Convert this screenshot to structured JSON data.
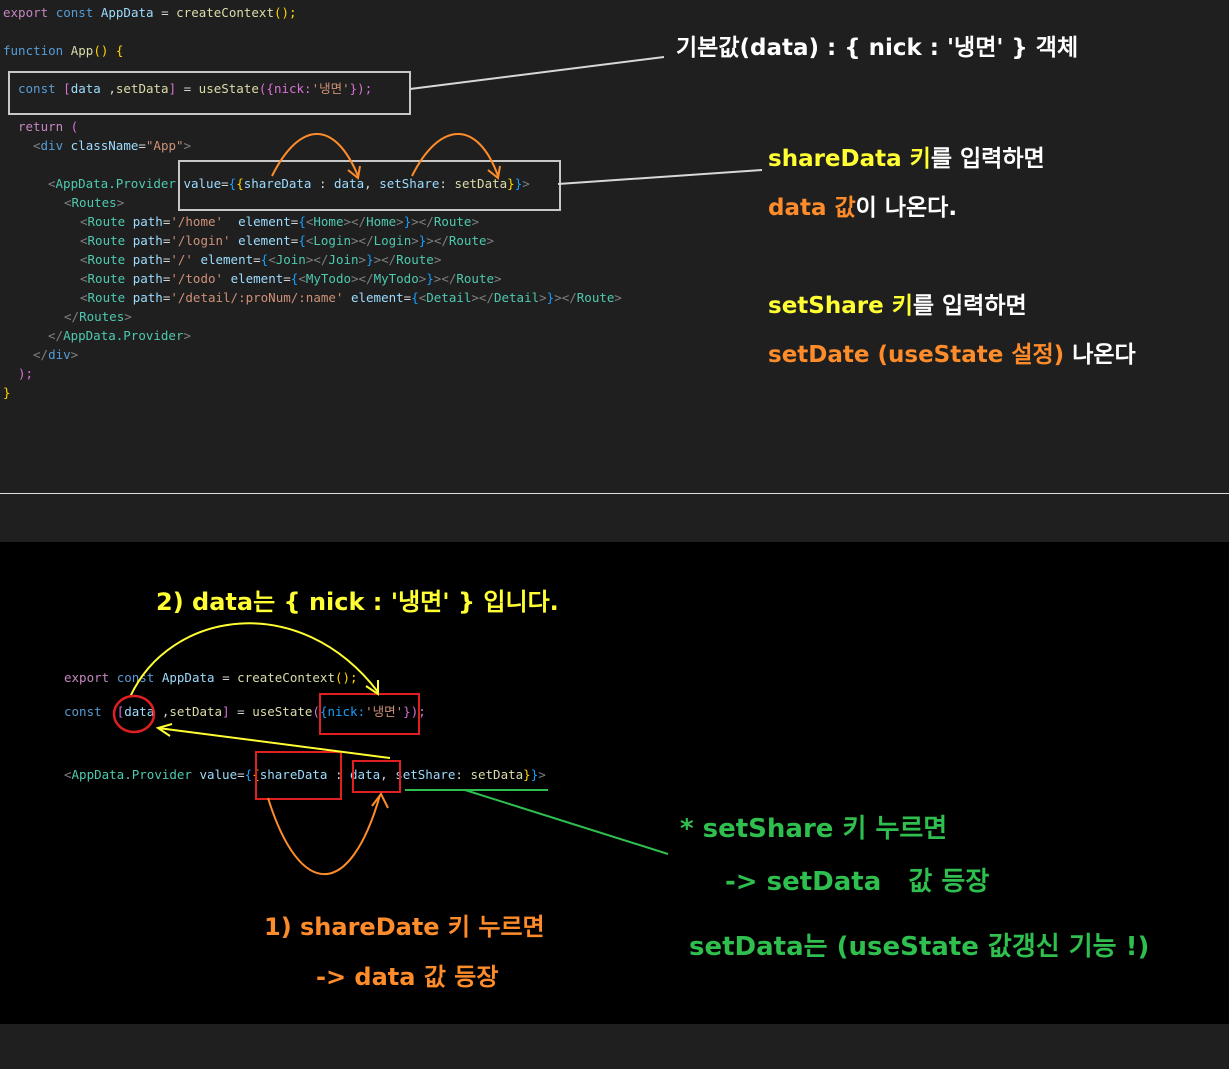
{
  "top_code": {
    "line1": {
      "kw1": "export",
      "kw2": "const",
      "name": "AppData",
      "eq": "=",
      "fn": "createContext",
      "rest": "();"
    },
    "line2": {
      "kw": "function",
      "fn": "App",
      "rest": "() {"
    },
    "line3": {
      "kw": "const",
      "open": "[",
      "v1": "data",
      "comma": " ,",
      "v2": "setData",
      "close": "]",
      "eq": " = ",
      "fn": "useState",
      "arg": "({nick:",
      "str": "'냉면'",
      "end": "});"
    },
    "line4": {
      "kw": "return",
      "rest": " ("
    },
    "line5": {
      "tag": "div",
      "attr": "className",
      "str": "\"App\""
    },
    "line6": {
      "tag": "AppData.Provider",
      "attr": "value",
      "k1": "shareData",
      "v1": "data",
      "k2": "setShare",
      "v2": "setData"
    },
    "line7": {
      "tag": "Routes"
    },
    "routes": [
      {
        "path": "'/home'",
        "comp": "Home",
        "pad": "  "
      },
      {
        "path": "'/login'",
        "comp": "Login",
        "pad": " "
      },
      {
        "path": "'/'",
        "comp": "Join",
        "pad": " "
      },
      {
        "path": "'/todo'",
        "comp": "MyTodo",
        "pad": " "
      },
      {
        "path": "'/detail/:proNum/:name'",
        "comp": "Detail",
        "pad": " "
      }
    ],
    "close_routes": "Routes",
    "close_provider": "AppData.Provider",
    "close_div": "div",
    "close_paren": ");",
    "close_brace": "}"
  },
  "top_annotations": {
    "default_value": "기본값(data) : { nick : '냉면' } 객체",
    "share_line1_a": "shareData 키",
    "share_line1_b": "를 입력하면",
    "share_line2_a": "data 값",
    "share_line2_b": "이 나온다.",
    "set_line1_a": "setShare 키",
    "set_line1_b": "를 입력하면",
    "set_line2_a": "setDate (useState 설정)",
    "set_line2_b": " 나온다"
  },
  "bottom_code": {
    "line1": {
      "kw1": "export",
      "kw2": "const",
      "name": "AppData",
      "eq": "=",
      "fn": "createContext",
      "rest": "();"
    },
    "line2": {
      "kw": "const",
      "v1": "data",
      "v2": "setData",
      "fn": "useState",
      "arg": "{nick:",
      "str": "'냉면'",
      "end": "});"
    },
    "line3": {
      "tag": "AppData.Provider",
      "attr": "value",
      "k1": "shareData",
      "v1": "data",
      "k2": "setShare",
      "v2": "setData"
    }
  },
  "bottom_annotations": {
    "step2": "2) data는 { nick : '냉면' } 입니다.",
    "step1_line1": "1) shareDate 키 누르면",
    "step1_line2": "-> data 값 등장",
    "green_line1": "* setShare 키 누르면",
    "green_line2": "-> setData   값 등장",
    "green_line3": "setData는 (useState 값갱신 기능 !)"
  },
  "colors": {
    "editor_bg": "#1f1f1f",
    "bottom_bg": "#000000",
    "annotation_yellow": "#ffff33",
    "annotation_orange": "#ff8c2a",
    "annotation_green": "#2fbf4f",
    "box_red": "#e02020",
    "box_gray": "#c8c8c8"
  }
}
